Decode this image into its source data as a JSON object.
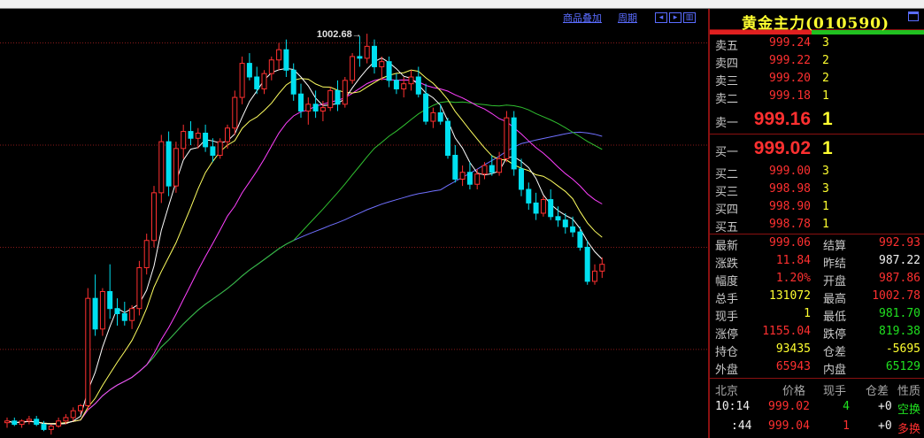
{
  "toolbar": {
    "overlay_label": "商品叠加",
    "period_label": "周期"
  },
  "panel": {
    "title": "黄金主力(010590)",
    "asks": [
      {
        "label": "卖五",
        "price": "999.24",
        "vol": "3"
      },
      {
        "label": "卖四",
        "price": "999.22",
        "vol": "2"
      },
      {
        "label": "卖三",
        "price": "999.20",
        "vol": "2"
      },
      {
        "label": "卖二",
        "price": "999.18",
        "vol": "1"
      },
      {
        "label": "卖一",
        "price": "999.16",
        "vol": "1"
      }
    ],
    "bids": [
      {
        "label": "买一",
        "price": "999.02",
        "vol": "1"
      },
      {
        "label": "买二",
        "price": "999.00",
        "vol": "3"
      },
      {
        "label": "买三",
        "price": "998.98",
        "vol": "3"
      },
      {
        "label": "买四",
        "price": "998.90",
        "vol": "1"
      },
      {
        "label": "买五",
        "price": "998.78",
        "vol": "1"
      }
    ],
    "quote": [
      {
        "l1": "最新",
        "v1": "999.06",
        "c1": "red",
        "l2": "结算",
        "v2": "992.93",
        "c2": "red"
      },
      {
        "l1": "涨跌",
        "v1": "11.84",
        "c1": "red",
        "l2": "昨结",
        "v2": "987.22",
        "c2": "white"
      },
      {
        "l1": "幅度",
        "v1": "1.20%",
        "c1": "red",
        "l2": "开盘",
        "v2": "987.86",
        "c2": "red"
      },
      {
        "l1": "总手",
        "v1": "131072",
        "c1": "yellow",
        "l2": "最高",
        "v2": "1002.78",
        "c2": "red"
      },
      {
        "l1": "现手",
        "v1": "1",
        "c1": "yellow",
        "l2": "最低",
        "v2": "981.70",
        "c2": "green"
      },
      {
        "l1": "涨停",
        "v1": "1155.04",
        "c1": "red",
        "l2": "跌停",
        "v2": "819.38",
        "c2": "green"
      },
      {
        "l1": "持仓",
        "v1": "93435",
        "c1": "yellow",
        "l2": "仓差",
        "v2": "-5695",
        "c2": "yellow"
      },
      {
        "l1": "外盘",
        "v1": "65943",
        "c1": "red",
        "l2": "内盘",
        "v2": "65129",
        "c2": "green"
      }
    ],
    "tick_header": {
      "place": "北京",
      "price": "价格",
      "vol": "现手",
      "oi": "仓差",
      "nature": "性质"
    },
    "ticks": [
      {
        "time": "10:14",
        "price": "999.02",
        "vol": "4",
        "vol_color": "green",
        "oi": "+0",
        "nature": "空换",
        "nature_color": "green"
      },
      {
        "time": ":44",
        "price": "999.04",
        "vol": "1",
        "vol_color": "red",
        "oi": "+0",
        "nature": "多换",
        "nature_color": "red"
      }
    ],
    "colors": {
      "up": "#ff3030",
      "down": "#20e020",
      "neutral": "#ffff30"
    }
  },
  "chart_data": {
    "type": "candlestick",
    "high_annotation": "1002.68",
    "ylim": [
      884,
      1010
    ],
    "gridlines": [
      1000,
      970,
      940,
      910
    ],
    "colors": {
      "up_candle": "#ff3030",
      "down_candle": "#00e0f0",
      "ma5": "#ffffff",
      "ma10": "#ffff60",
      "ma20": "#ff40ff",
      "ma40": "#30c030",
      "ma60": "#7070ff"
    },
    "candles": [
      {
        "o": 888.5,
        "h": 890.0,
        "l": 887.0,
        "c": 889.0
      },
      {
        "o": 889.0,
        "h": 890.0,
        "l": 887.5,
        "c": 888.0
      },
      {
        "o": 888.0,
        "h": 889.5,
        "l": 887.0,
        "c": 889.0
      },
      {
        "o": 889.0,
        "h": 890.5,
        "l": 888.0,
        "c": 889.5
      },
      {
        "o": 889.5,
        "h": 890.5,
        "l": 887.5,
        "c": 888.0
      },
      {
        "o": 888.0,
        "h": 889.0,
        "l": 886.0,
        "c": 886.5
      },
      {
        "o": 886.5,
        "h": 888.0,
        "l": 885.0,
        "c": 887.5
      },
      {
        "o": 887.5,
        "h": 890.0,
        "l": 887.0,
        "c": 889.0
      },
      {
        "o": 889.0,
        "h": 891.0,
        "l": 888.0,
        "c": 890.0
      },
      {
        "o": 890.0,
        "h": 893.0,
        "l": 889.0,
        "c": 892.0
      },
      {
        "o": 892.0,
        "h": 894.0,
        "l": 891.0,
        "c": 893.5
      },
      {
        "o": 893.5,
        "h": 928.0,
        "l": 892.0,
        "c": 925.0
      },
      {
        "o": 925.0,
        "h": 932.0,
        "l": 914.0,
        "c": 916.0
      },
      {
        "o": 916.0,
        "h": 928.0,
        "l": 914.0,
        "c": 927.0
      },
      {
        "o": 927.0,
        "h": 935.0,
        "l": 919.0,
        "c": 922.0
      },
      {
        "o": 922.0,
        "h": 925.0,
        "l": 917.0,
        "c": 920.5
      },
      {
        "o": 920.5,
        "h": 924.0,
        "l": 917.0,
        "c": 918.5
      },
      {
        "o": 918.5,
        "h": 923.0,
        "l": 916.0,
        "c": 922.0
      },
      {
        "o": 922.0,
        "h": 936.0,
        "l": 920.0,
        "c": 934.0
      },
      {
        "o": 934.0,
        "h": 944.0,
        "l": 932.0,
        "c": 942.0
      },
      {
        "o": 942.0,
        "h": 958.0,
        "l": 940.0,
        "c": 956.0
      },
      {
        "o": 956.0,
        "h": 973.0,
        "l": 953.0,
        "c": 971.0
      },
      {
        "o": 971.0,
        "h": 974.0,
        "l": 955.0,
        "c": 958.0
      },
      {
        "o": 958.0,
        "h": 971.0,
        "l": 956.0,
        "c": 969.0
      },
      {
        "o": 969.0,
        "h": 976.0,
        "l": 966.0,
        "c": 974.0
      },
      {
        "o": 974.0,
        "h": 977.0,
        "l": 970.0,
        "c": 972.0
      },
      {
        "o": 972.0,
        "h": 975.0,
        "l": 969.0,
        "c": 973.5
      },
      {
        "o": 973.5,
        "h": 976.0,
        "l": 968.0,
        "c": 969.5
      },
      {
        "o": 969.5,
        "h": 972.0,
        "l": 965.0,
        "c": 967.0
      },
      {
        "o": 967.0,
        "h": 972.0,
        "l": 966.0,
        "c": 971.0
      },
      {
        "o": 971.0,
        "h": 976.0,
        "l": 969.0,
        "c": 975.0
      },
      {
        "o": 975.0,
        "h": 986.0,
        "l": 973.0,
        "c": 984.0
      },
      {
        "o": 984.0,
        "h": 996.0,
        "l": 982.0,
        "c": 994.0
      },
      {
        "o": 994.0,
        "h": 997.0,
        "l": 989.0,
        "c": 990.0
      },
      {
        "o": 990.0,
        "h": 993.0,
        "l": 985.0,
        "c": 986.5
      },
      {
        "o": 986.5,
        "h": 992.0,
        "l": 985.0,
        "c": 991.0
      },
      {
        "o": 991.0,
        "h": 996.0,
        "l": 989.0,
        "c": 995.0
      },
      {
        "o": 995.0,
        "h": 1000.0,
        "l": 992.0,
        "c": 998.0
      },
      {
        "o": 998.0,
        "h": 1001.0,
        "l": 990.0,
        "c": 992.0
      },
      {
        "o": 992.0,
        "h": 994.0,
        "l": 983.0,
        "c": 985.0
      },
      {
        "o": 985.0,
        "h": 988.0,
        "l": 978.0,
        "c": 980.0
      },
      {
        "o": 980.0,
        "h": 984.0,
        "l": 976.0,
        "c": 982.0
      },
      {
        "o": 982.0,
        "h": 986.0,
        "l": 978.0,
        "c": 980.0
      },
      {
        "o": 980.0,
        "h": 983.0,
        "l": 977.0,
        "c": 981.0
      },
      {
        "o": 981.0,
        "h": 987.0,
        "l": 980.0,
        "c": 986.0
      },
      {
        "o": 986.0,
        "h": 989.0,
        "l": 980.0,
        "c": 982.0
      },
      {
        "o": 982.0,
        "h": 990.0,
        "l": 981.0,
        "c": 989.0
      },
      {
        "o": 989.0,
        "h": 997.0,
        "l": 988.0,
        "c": 996.0
      },
      {
        "o": 996.0,
        "h": 1002.0,
        "l": 993.0,
        "c": 995.5
      },
      {
        "o": 995.5,
        "h": 1002.7,
        "l": 994.0,
        "c": 999.0
      },
      {
        "o": 999.0,
        "h": 1001.0,
        "l": 991.0,
        "c": 993.0
      },
      {
        "o": 993.0,
        "h": 996.0,
        "l": 989.0,
        "c": 994.5
      },
      {
        "o": 994.5,
        "h": 996.0,
        "l": 987.0,
        "c": 989.0
      },
      {
        "o": 989.0,
        "h": 991.0,
        "l": 985.0,
        "c": 986.5
      },
      {
        "o": 986.5,
        "h": 990.0,
        "l": 984.0,
        "c": 988.0
      },
      {
        "o": 988.0,
        "h": 992.0,
        "l": 986.0,
        "c": 990.0
      },
      {
        "o": 990.0,
        "h": 993.0,
        "l": 984.0,
        "c": 985.0
      },
      {
        "o": 985.0,
        "h": 988.0,
        "l": 976.0,
        "c": 977.0
      },
      {
        "o": 977.0,
        "h": 981.0,
        "l": 975.0,
        "c": 979.5
      },
      {
        "o": 979.5,
        "h": 982.0,
        "l": 976.0,
        "c": 977.0
      },
      {
        "o": 977.0,
        "h": 978.0,
        "l": 966.0,
        "c": 967.0
      },
      {
        "o": 967.0,
        "h": 970.0,
        "l": 959.0,
        "c": 960.0
      },
      {
        "o": 960.0,
        "h": 964.0,
        "l": 958.0,
        "c": 962.0
      },
      {
        "o": 962.0,
        "h": 965.0,
        "l": 957.0,
        "c": 958.5
      },
      {
        "o": 958.5,
        "h": 963.0,
        "l": 957.0,
        "c": 961.5
      },
      {
        "o": 961.5,
        "h": 965.0,
        "l": 960.0,
        "c": 964.0
      },
      {
        "o": 964.0,
        "h": 967.0,
        "l": 961.0,
        "c": 962.0
      },
      {
        "o": 962.0,
        "h": 968.0,
        "l": 961.0,
        "c": 966.0
      },
      {
        "o": 966.0,
        "h": 980.0,
        "l": 965.0,
        "c": 978.0
      },
      {
        "o": 978.0,
        "h": 980.0,
        "l": 961.0,
        "c": 963.0
      },
      {
        "o": 963.0,
        "h": 966.0,
        "l": 955.0,
        "c": 957.0
      },
      {
        "o": 957.0,
        "h": 959.0,
        "l": 951.0,
        "c": 953.0
      },
      {
        "o": 953.0,
        "h": 956.0,
        "l": 948.0,
        "c": 950.0
      },
      {
        "o": 950.0,
        "h": 955.0,
        "l": 949.0,
        "c": 954.0
      },
      {
        "o": 954.0,
        "h": 957.0,
        "l": 948.0,
        "c": 949.0
      },
      {
        "o": 949.0,
        "h": 952.0,
        "l": 946.0,
        "c": 948.0
      },
      {
        "o": 948.0,
        "h": 950.0,
        "l": 944.0,
        "c": 946.0
      },
      {
        "o": 946.0,
        "h": 949.0,
        "l": 943.0,
        "c": 944.5
      },
      {
        "o": 944.5,
        "h": 946.0,
        "l": 939.0,
        "c": 940.0
      },
      {
        "o": 940.0,
        "h": 942.0,
        "l": 929.0,
        "c": 930.0
      },
      {
        "o": 930.0,
        "h": 935.0,
        "l": 929.0,
        "c": 933.0
      },
      {
        "o": 933.0,
        "h": 937.0,
        "l": 931.0,
        "c": 935.0
      }
    ]
  }
}
